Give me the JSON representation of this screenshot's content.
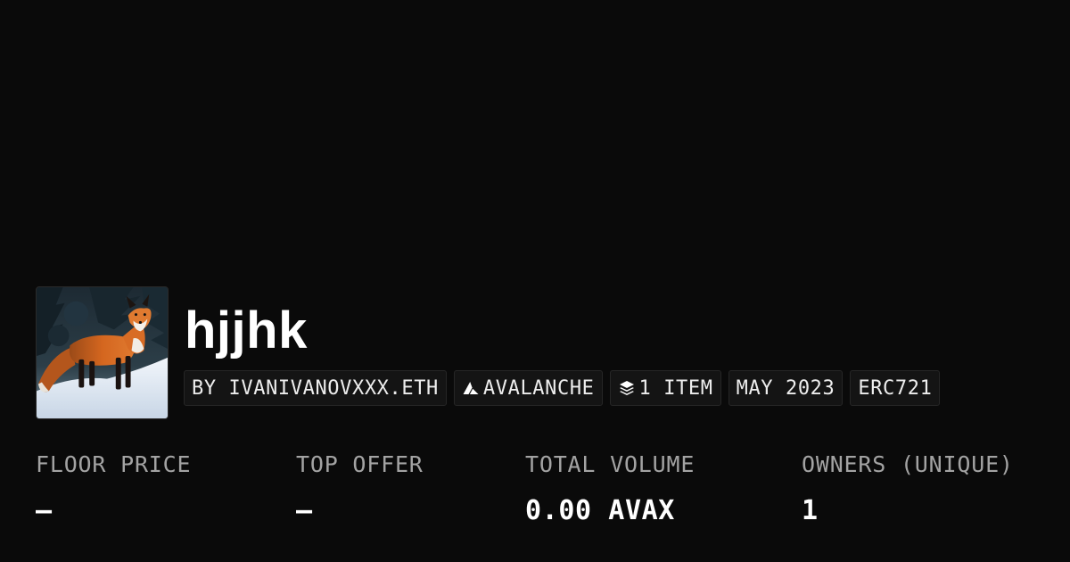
{
  "collection": {
    "name": "hjjhk",
    "avatar_alt": "red fox standing in snow"
  },
  "tags": {
    "creator": "BY IVANIVANOVXXX.ETH",
    "chain": "AVALANCHE",
    "chain_icon": "avalanche-logo-icon",
    "items": "1 ITEM",
    "items_icon": "stack-layers-icon",
    "date": "MAY 2023",
    "standard": "ERC721"
  },
  "stats": {
    "floor_price": {
      "label": "FLOOR PRICE",
      "value": "–"
    },
    "top_offer": {
      "label": "TOP OFFER",
      "value": "–"
    },
    "total_volume": {
      "label": "TOTAL VOLUME",
      "value": "0.00 AVAX"
    },
    "owners": {
      "label": "OWNERS (UNIQUE)",
      "value": "1"
    }
  },
  "colors": {
    "background": "#0a0a0a",
    "tag_background": "#141414",
    "label": "#a3a3a3",
    "text": "#ffffff"
  }
}
